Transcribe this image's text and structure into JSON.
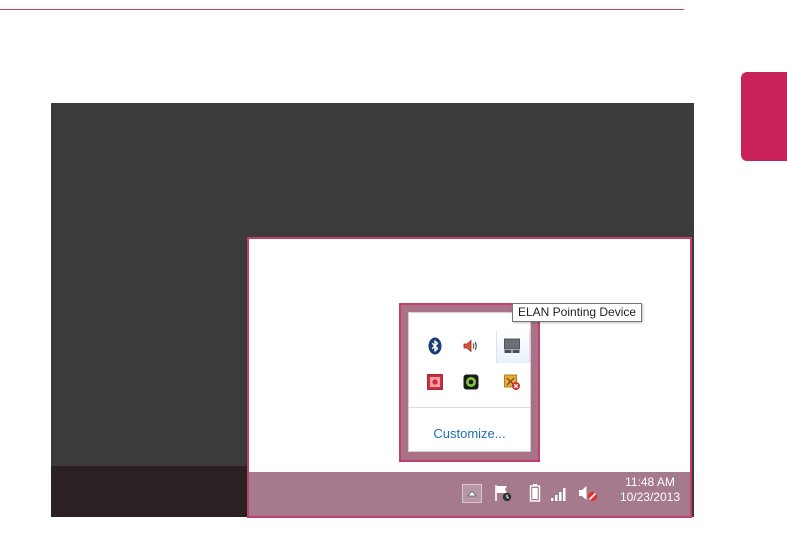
{
  "tooltip": {
    "text": "ELAN Pointing Device"
  },
  "overflow_panel": {
    "customize_label": "Customize...",
    "icons": [
      "bluetooth-icon",
      "volume-icon",
      "touchpad-icon",
      "antivirus-icon",
      "camera-app-icon",
      "network-error-icon"
    ]
  },
  "taskbar": {
    "time": "11:48 AM",
    "date": "10/23/2013",
    "icons": [
      "show-hidden-icons-button",
      "action-center-icon",
      "battery-icon",
      "signal-icon",
      "speaker-muted-icon"
    ]
  },
  "colors": {
    "accent": "#c9225a",
    "taskbar": "#a47a8c",
    "desktop": "#3b3b3b",
    "link": "#1e6fb4"
  }
}
